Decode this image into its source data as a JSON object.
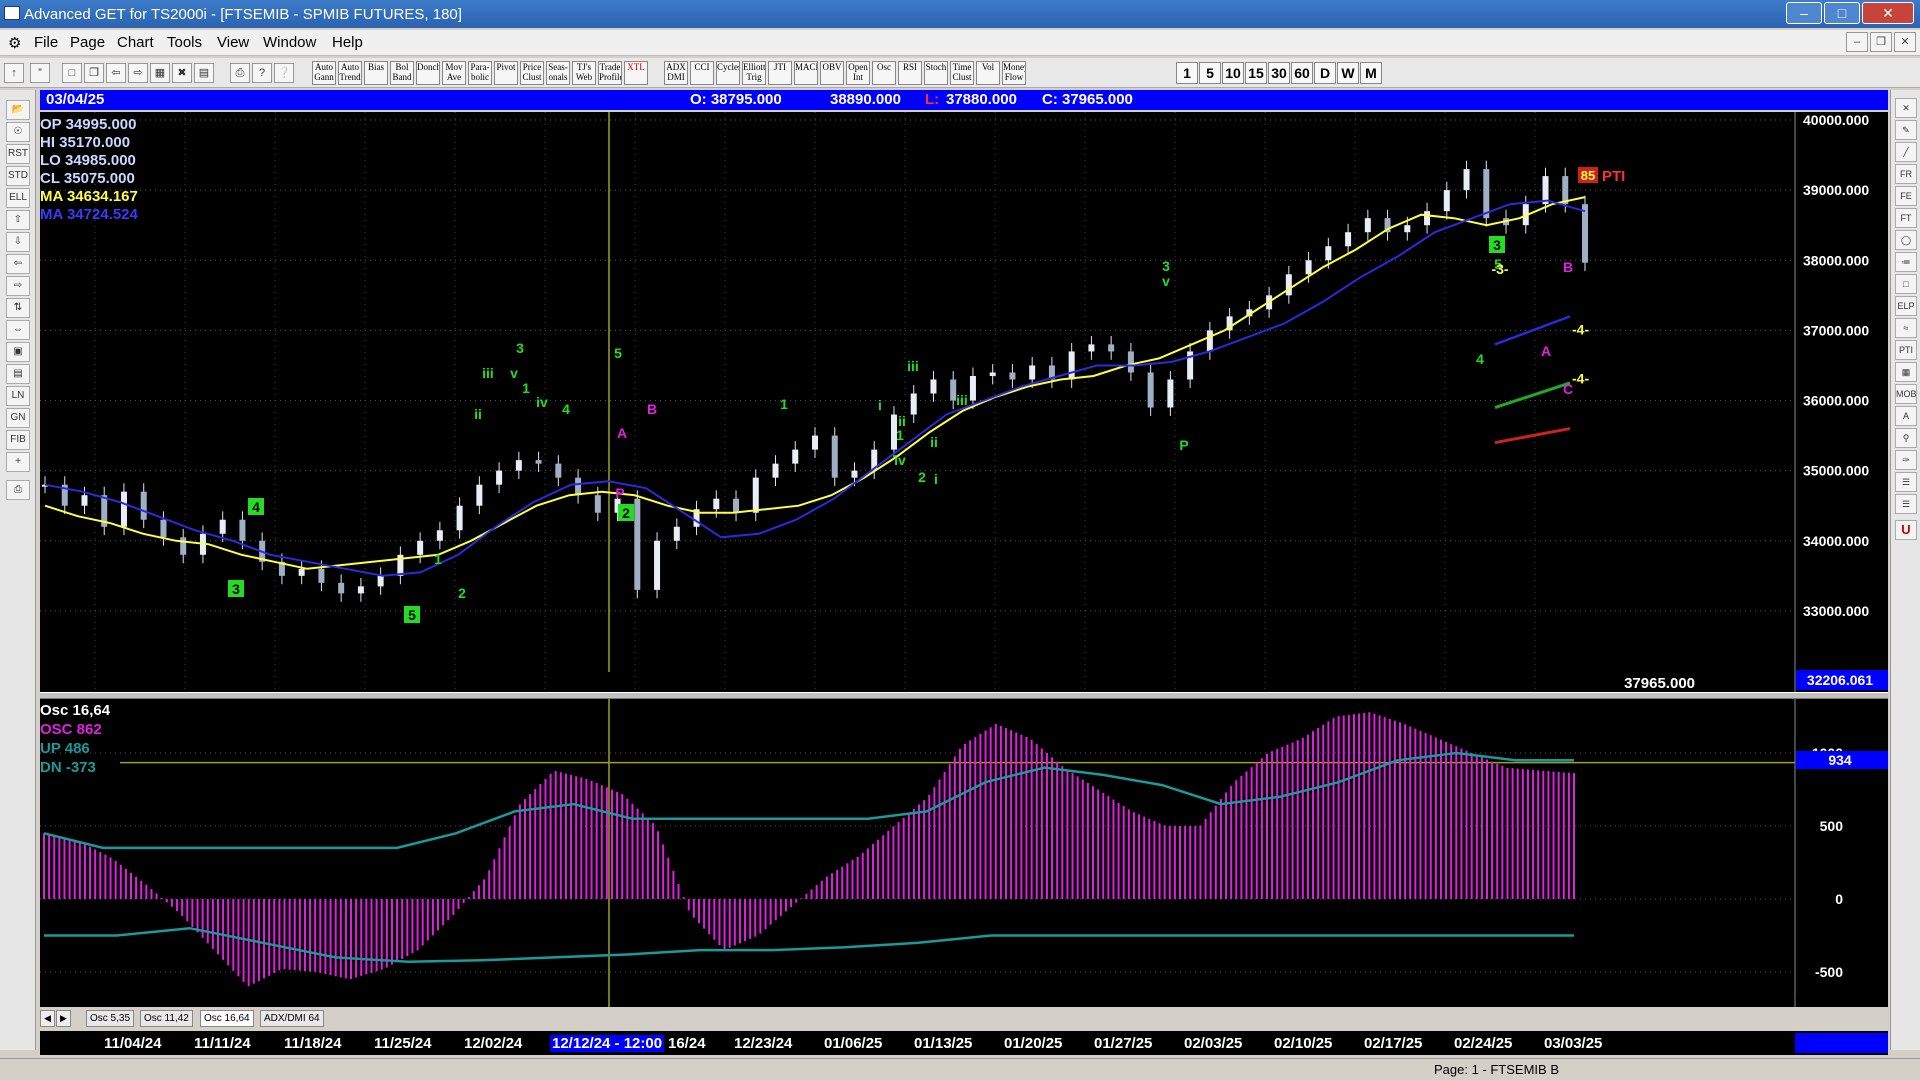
{
  "window": {
    "title": "Advanced GET for TS2000i - [FTSEMIB - SPMIB FUTURES, 180]"
  },
  "menu": [
    "File",
    "Page",
    "Chart",
    "Tools",
    "View",
    "Window",
    "Help"
  ],
  "toolbar": {
    "study_buttons": [
      "Auto Gann",
      "Auto Trend",
      "Bias",
      "Bol Band",
      "Donch",
      "Mov Ave",
      "Para-bolic",
      "Pivot",
      "Price Clust",
      "Seas-onals",
      "TJ's Web",
      "Trade Profile",
      "XTL",
      "ADX DMI",
      "CCI",
      "Cycles",
      "Elliott Trig",
      "JTI",
      "MACD",
      "OBV",
      "Open Int",
      "Osc",
      "RSI",
      "Stoch",
      "Time Clust",
      "Vol",
      "Money Flow"
    ],
    "periods": [
      "1",
      "5",
      "10",
      "15",
      "30",
      "60",
      "D",
      "W",
      "M"
    ]
  },
  "infobar": {
    "date": "03/04/25",
    "open": "O: 38795.000",
    "high": "38890.000",
    "low_label": "L:",
    "low": "37880.000",
    "close": "C: 37965.000"
  },
  "stats": {
    "op": "OP 34995.000",
    "hi": "HI  35170.000",
    "lo": "LO  34985.000",
    "cl": "CL  35075.000",
    "ma_yellow": "MA  34634.167",
    "ma_blue": "MA  34724.524"
  },
  "price_axis": {
    "ticks": [
      "40000.000",
      "39000.000",
      "38000.000",
      "37000.000",
      "36000.000",
      "35000.000",
      "34000.000",
      "33000.000"
    ],
    "last_price": "37965.000",
    "current_box": "32206.061"
  },
  "pti": {
    "value": "85",
    "label": "PTI"
  },
  "projections": [
    "-4-",
    "-4-"
  ],
  "wave_labels": [
    "4",
    "3",
    "5",
    "1",
    "2",
    "3",
    "v",
    "iii",
    "iv",
    "4",
    "ii",
    "1",
    "5",
    "B",
    "A",
    "P",
    "2",
    "1",
    "ii",
    "i",
    "iii",
    "1",
    "iii",
    "iv",
    "2",
    "ii",
    "i",
    "P",
    "3",
    "v",
    "3",
    "5",
    "-3-",
    "4",
    "B",
    "A",
    "C"
  ],
  "oscillator": {
    "title": "Osc 16,64",
    "osc": "OSC 862",
    "up": "UP  486",
    "dn": "DN  -373",
    "axis_ticks": [
      "1000",
      "500",
      "0",
      "-500"
    ],
    "current_box": "934"
  },
  "chart_data": {
    "type": "candlestick",
    "symbol": "FTSEMIB - SPMIB FUTURES",
    "interval": "180",
    "ylim": [
      32300,
      40000
    ],
    "date_ticks": [
      "11/04/24",
      "11/11/24",
      "11/18/24",
      "11/25/24",
      "12/02/24",
      "12/12/24 - 12:00",
      "16/24",
      "12/23/24",
      "01/06/25",
      "01/13/25",
      "01/20/25",
      "01/27/25",
      "02/03/25",
      "02/10/25",
      "02/17/25",
      "02/24/25",
      "03/03/25"
    ],
    "price_path": [
      34800,
      34500,
      34650,
      34200,
      34700,
      34300,
      34050,
      33800,
      34100,
      34300,
      34000,
      33700,
      33500,
      33600,
      33400,
      33250,
      33350,
      33500,
      33800,
      34000,
      34150,
      34500,
      34800,
      35000,
      35150,
      35100,
      34900,
      34650,
      34400,
      34600,
      33300,
      34000,
      34200,
      34450,
      34600,
      34400,
      34900,
      35100,
      35300,
      35500,
      34900,
      35000,
      35300,
      35800,
      36100,
      36300,
      36000,
      36350,
      36400,
      36300,
      36500,
      36300,
      36700,
      36800,
      36700,
      36400,
      35900,
      36300,
      36700,
      37000,
      37200,
      37300,
      37500,
      37800,
      38000,
      38200,
      38400,
      38600,
      38400,
      38500,
      38700,
      39000,
      39300,
      38600,
      38500,
      38800,
      39200,
      38800,
      37965
    ],
    "ma_yellow_path": [
      34500,
      34350,
      34250,
      34100,
      34000,
      33950,
      33800,
      33700,
      33600,
      33650,
      33700,
      33750,
      33800,
      34000,
      34250,
      34500,
      34650,
      34700,
      34650,
      34500,
      34400,
      34400,
      34450,
      34500,
      34650,
      34900,
      35200,
      35550,
      35850,
      36050,
      36200,
      36300,
      36350,
      36500,
      36600,
      36800,
      37000,
      37300,
      37600,
      37900,
      38150,
      38450,
      38650,
      38600,
      38500,
      38600,
      38800,
      38900
    ],
    "ma_blue_path": [
      34800,
      34700,
      34550,
      34350,
      34150,
      34000,
      33800,
      33700,
      33600,
      33500,
      33550,
      33800,
      34200,
      34550,
      34800,
      34850,
      34750,
      34400,
      34050,
      34100,
      34300,
      34600,
      35000,
      35400,
      35800,
      36000,
      36200,
      36350,
      36500,
      36500,
      36550,
      36700,
      36900,
      37100,
      37400,
      37750,
      38050,
      38400,
      38600,
      38800,
      38850,
      38700
    ],
    "osc_hist": [
      450,
      400,
      280,
      100,
      -100,
      -350,
      -600,
      -480,
      -500,
      -550,
      -480,
      -350,
      -120,
      150,
      650,
      880,
      820,
      720,
      500,
      -100,
      -350,
      -250,
      -50,
      150,
      300,
      500,
      700,
      1050,
      1200,
      1100,
      900,
      750,
      600,
      500,
      500,
      800,
      1000,
      1100,
      1250,
      1280,
      1200,
      1100,
      1000,
      900,
      880,
      862
    ],
    "osc_up_line": [
      450,
      350,
      350,
      350,
      350,
      350,
      350,
      450,
      600,
      650,
      550,
      550,
      550,
      550,
      550,
      600,
      800,
      900,
      850,
      780,
      650,
      700,
      800,
      950,
      1000,
      950,
      950
    ],
    "osc_dn_line": [
      -250,
      -250,
      -200,
      -300,
      -400,
      -430,
      -420,
      -400,
      -380,
      -350,
      -350,
      -330,
      -300,
      -250,
      -250,
      -250,
      -250,
      -250,
      -250,
      -250,
      -250,
      -250
    ]
  },
  "tabs": [
    "Osc 5,35",
    "Osc 11,42",
    "Osc 16,64",
    "ADX/DMI 64"
  ],
  "status": {
    "page": "Page: 1 - FTSEMIB B"
  },
  "colors": {
    "blue_bar": "#0000ff",
    "magenta": "#e020e0",
    "teal": "#1a9a9a",
    "yellow_ma": "#ffff40",
    "blue_ma": "#2a2adf",
    "wave_green": "#22dd22"
  }
}
